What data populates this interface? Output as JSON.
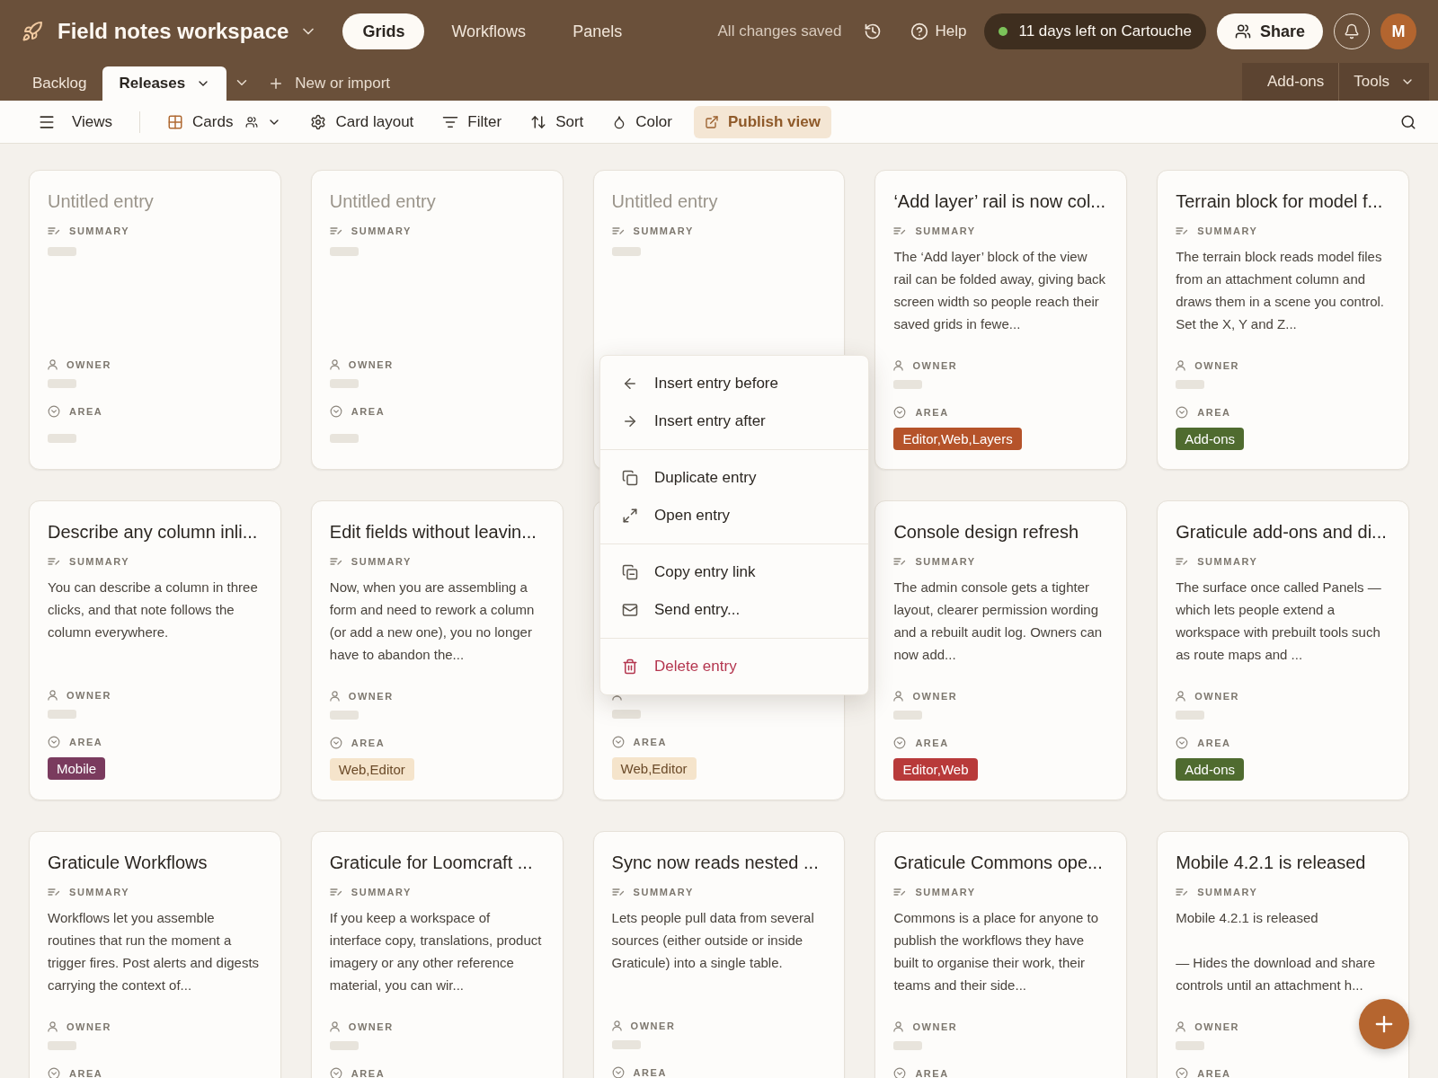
{
  "header": {
    "workspace": "Field notes workspace",
    "nav": [
      {
        "label": "Grids",
        "selected": true
      },
      {
        "label": "Workflows",
        "selected": false
      },
      {
        "label": "Panels",
        "selected": false
      }
    ],
    "status": "All changes saved",
    "help": "Help",
    "trial": {
      "label": "11 days left on Cartouche",
      "color": "#7cc35a"
    },
    "share": "Share",
    "avatar": "M"
  },
  "tabs": [
    {
      "label": "Backlog",
      "selected": false
    },
    {
      "label": "Releases",
      "selected": true
    }
  ],
  "new_tab": "New or import",
  "right_tabs": [
    "Add-ons",
    "Tools"
  ],
  "toolbar": [
    {
      "kind": "views",
      "label": "Views"
    },
    {
      "kind": "cards",
      "label": "Cards"
    },
    {
      "kind": "layout",
      "label": "Card layout"
    },
    {
      "kind": "filter",
      "label": "Filter"
    },
    {
      "kind": "sort",
      "label": "Sort"
    },
    {
      "kind": "color",
      "label": "Color"
    },
    {
      "kind": "publish",
      "label": "Publish view"
    }
  ],
  "cards": [
    {
      "title": "Untitled entry",
      "untitled": true,
      "summary_label": "SUMMARY",
      "owner_label": "OWNER",
      "area_label": "AREA"
    },
    {
      "title": "Untitled entry",
      "untitled": true,
      "summary_label": "SUMMARY",
      "owner_label": "OWNER",
      "area_label": "AREA"
    },
    {
      "title": "Untitled entry",
      "untitled": true,
      "summary_label": "SUMMARY"
    },
    {
      "title": "‘Add layer’ rail is now col...",
      "untitled": false,
      "summary_label": "SUMMARY",
      "summary": "The ‘Add layer’ block of the view rail can be folded away, giving back screen width so people reach their saved grids in fewe...",
      "owner_label": "OWNER",
      "area_label": "AREA",
      "area": {
        "label": "Editor,Web,Layers",
        "color": "#b5532a"
      }
    },
    {
      "title": "Terrain block for model f...",
      "untitled": false,
      "summary_label": "SUMMARY",
      "summary": "The terrain block reads model files from an attachment column and draws them in a scene you control. Set the X, Y and Z...",
      "owner_label": "OWNER",
      "area_label": "AREA",
      "area": {
        "label": "Add-ons",
        "color": "#4f6b2f"
      }
    },
    {
      "title": "Describe any column inli...",
      "untitled": false,
      "summary_label": "SUMMARY",
      "summary": "You can describe a column in three clicks, and that note follows the column everywhere.",
      "owner_label": "OWNER",
      "area_label": "AREA",
      "area": {
        "label": "Mobile",
        "color": "#7a3b5e"
      }
    },
    {
      "title": "Edit fields without leavin...",
      "untitled": false,
      "summary_label": "SUMMARY",
      "summary": "Now, when you are assembling a form and need to rework a column (or add a new one), you no longer have to abandon the...",
      "owner_label": "OWNER",
      "area_label": "AREA",
      "area": {
        "label": "Web,Editor",
        "color": "#f5e4cb"
      }
    },
    {
      "area_label": "AREA",
      "area": {
        "label": "Web,Editor",
        "color": "#f5e4cb"
      }
    },
    {
      "title": "Console design refresh",
      "untitled": false,
      "summary_label": "SUMMARY",
      "summary": "The admin console gets a tighter layout, clearer permission wording and a rebuilt audit log. Owners can now add...",
      "owner_label": "OWNER",
      "area_label": "AREA",
      "area": {
        "label": "Editor,Web",
        "color": "#b83a3a"
      }
    },
    {
      "title": "Graticule add-ons and di...",
      "untitled": false,
      "summary_label": "SUMMARY",
      "summary": "The surface once called Panels — which lets people extend a workspace with prebuilt tools such as route maps and ...",
      "owner_label": "OWNER",
      "area_label": "AREA",
      "area": {
        "label": "Add-ons",
        "color": "#4f6b2f"
      }
    },
    {
      "title": "Graticule Workflows",
      "untitled": false,
      "summary_label": "SUMMARY",
      "summary": "Workflows let you assemble routines that run the moment a trigger fires. Post alerts and digests carrying the context of...",
      "owner_label": "OWNER",
      "area_label": "AREA"
    },
    {
      "title": "Graticule for Loomcraft ...",
      "untitled": false,
      "summary_label": "SUMMARY",
      "summary": "If you keep a workspace of interface copy, translations, product imagery or any other reference material, you can wir...",
      "owner_label": "OWNER",
      "area_label": "AREA"
    },
    {
      "title": "Sync now reads nested ...",
      "untitled": false,
      "summary_label": "SUMMARY",
      "summary": "Lets people pull data from several sources (either outside or inside Graticule) into a single table.",
      "owner_label": "OWNER",
      "area_label": "AREA"
    },
    {
      "title": "Graticule Commons ope...",
      "untitled": false,
      "summary_label": "SUMMARY",
      "summary": "Commons is a place for anyone to publish the workflows they have built to organise their work, their teams and their side...",
      "owner_label": "OWNER",
      "area_label": "AREA"
    },
    {
      "title": "Mobile 4.2.1 is released",
      "untitled": false,
      "summary_label": "SUMMARY",
      "summary": "Mobile 4.2.1 is released\n\n— Hides the download and share controls until an attachment h...",
      "owner_label": "OWNER",
      "area_label": "AREA"
    }
  ],
  "context_menu": [
    [
      {
        "kind": "before",
        "label": "Insert entry before"
      },
      {
        "kind": "after",
        "label": "Insert entry after"
      }
    ],
    [
      {
        "kind": "duplicate",
        "label": "Duplicate entry"
      },
      {
        "kind": "open",
        "label": "Open entry"
      }
    ],
    [
      {
        "kind": "link",
        "label": "Copy entry link"
      },
      {
        "kind": "send",
        "label": "Send entry..."
      }
    ],
    [
      {
        "kind": "delete",
        "label": "Delete entry"
      }
    ]
  ]
}
